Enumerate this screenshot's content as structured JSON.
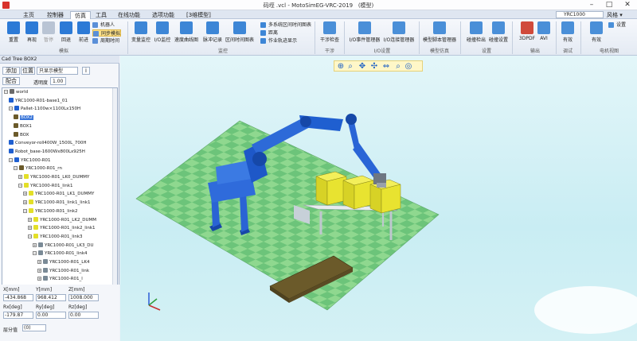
{
  "window": {
    "title": "码垤 .vcl - MotoSimEG-VRC-2019",
    "subtitle": "(模型)",
    "minimize": "–",
    "maximize": "□",
    "close": "✕"
  },
  "menu": {
    "items": [
      "主页",
      "控制器",
      "仿真",
      "工具",
      "在线功能",
      "选项功能",
      "[3维模型]"
    ],
    "active_index": 2,
    "search_value": "YRC1000",
    "style_label": "风格 ▾"
  },
  "ribbon": {
    "playback": [
      "重置",
      "再现",
      "暂停",
      "回退",
      "前进"
    ],
    "mode": [
      "机器人",
      "同步模拟",
      "周期时间"
    ],
    "monitor": [
      "变量监控",
      "I/O监控",
      "速度曲线图",
      "脉冲记录",
      "区间时间图表"
    ],
    "monitor_small": [
      "多系统区间时间图表",
      "距离",
      "作业轨迹显示"
    ],
    "interference": [
      "干涉检查"
    ],
    "io": [
      "I/O事件管理器",
      "I/O连接管理器"
    ],
    "model": [
      "模型脚本管理器"
    ],
    "settings": [
      "碰撞检出",
      "碰撞设置"
    ],
    "output": [
      "3DPDF",
      "AVI"
    ],
    "debug": [
      "有效"
    ],
    "camera": [
      "有效",
      "设置"
    ],
    "groups": [
      "模拟",
      "监控",
      "干涉",
      "I/O设置",
      "模型仿真",
      "设置",
      "输出",
      "调试",
      "电机视图"
    ]
  },
  "left_panel": {
    "title": "Cad Tree BOX2",
    "add_button": "添加",
    "position_button": "位置",
    "display_mode": "只显示模型",
    "info_button": "i",
    "fit_button": "配合",
    "transparency_label": "透明度",
    "transparency_value": "1.00",
    "tree": [
      {
        "text": "world",
        "depth": 0,
        "exp": "−"
      },
      {
        "text": "YRC1000-R01-base1_01",
        "depth": 1,
        "exp": ""
      },
      {
        "text": "Pallet-1100w×1100Lx150H",
        "depth": 1,
        "exp": "−"
      },
      {
        "text": "BOX2",
        "depth": 2,
        "exp": "",
        "selected": true
      },
      {
        "text": "BOX1",
        "depth": 2,
        "exp": ""
      },
      {
        "text": "BOX",
        "depth": 2,
        "exp": ""
      },
      {
        "text": "Conveyor-roll400W_1500L_700H",
        "depth": 1,
        "exp": ""
      },
      {
        "text": "Robot_base-1600Wx800Lx925H",
        "depth": 1,
        "exp": ""
      },
      {
        "text": "YRC1000-R01",
        "depth": 1,
        "exp": "−"
      },
      {
        "text": "YRC1000-R01_rn",
        "depth": 2,
        "exp": "−"
      },
      {
        "text": "YRC1000-R01_LK0_DUMMY",
        "depth": 3,
        "exp": "+"
      },
      {
        "text": "YRC1000-R01_link1",
        "depth": 3,
        "exp": "−"
      },
      {
        "text": "YRC1000-R01_LK1_DUMMY",
        "depth": 4,
        "exp": "+"
      },
      {
        "text": "YRC1000-R01_link1_link1",
        "depth": 4,
        "exp": "+"
      },
      {
        "text": "YRC1000-R01_link2",
        "depth": 4,
        "exp": "−"
      },
      {
        "text": "YRC1000-R01_LK2_DUMM",
        "depth": 5,
        "exp": "+"
      },
      {
        "text": "YRC1000-R01_link2_link1",
        "depth": 5,
        "exp": "+"
      },
      {
        "text": "YRC1000-R01_link3",
        "depth": 5,
        "exp": "−"
      },
      {
        "text": "YRC1000-R01_LK3_DU",
        "depth": 6,
        "exp": "+"
      },
      {
        "text": "YRC1000-R01_link4",
        "depth": 6,
        "exp": "−"
      },
      {
        "text": "YRC1000-R01_LK4",
        "depth": 7,
        "exp": "+"
      },
      {
        "text": "YRC1000-R01_link",
        "depth": 7,
        "exp": "+"
      },
      {
        "text": "YRC1000-R01_l",
        "depth": 7,
        "exp": "+"
      },
      {
        "text": "YRC1000-R01_",
        "depth": 7,
        "exp": "−"
      },
      {
        "text": "YRC1000-F",
        "depth": 8,
        "exp": "+"
      },
      {
        "text": "YRC1000-F",
        "depth": 8,
        "exp": "−"
      },
      {
        "text": "TOOL",
        "depth": 9,
        "exp": ""
      },
      {
        "text": "YRC100",
        "depth": 9,
        "exp": ""
      }
    ],
    "coords": {
      "x_label": "X[mm]",
      "y_label": "Y[mm]",
      "z_label": "Z[mm]",
      "rx_label": "Rx[deg]",
      "ry_label": "Ry[deg]",
      "rz_label": "Rz[deg]",
      "x": "-434.868",
      "y": "968.412",
      "z": "1008.000",
      "rx": "-179.87",
      "ry": "0.00",
      "rz": "0.00"
    },
    "layer_label": "层分值",
    "layer_value": "(0)"
  },
  "colors": {
    "robot": "#1f5fd0",
    "box": "#e3df28",
    "pallet": "#6b5a2a",
    "floor_light": "#8fd88f",
    "floor_dark": "#5fbf6f"
  }
}
